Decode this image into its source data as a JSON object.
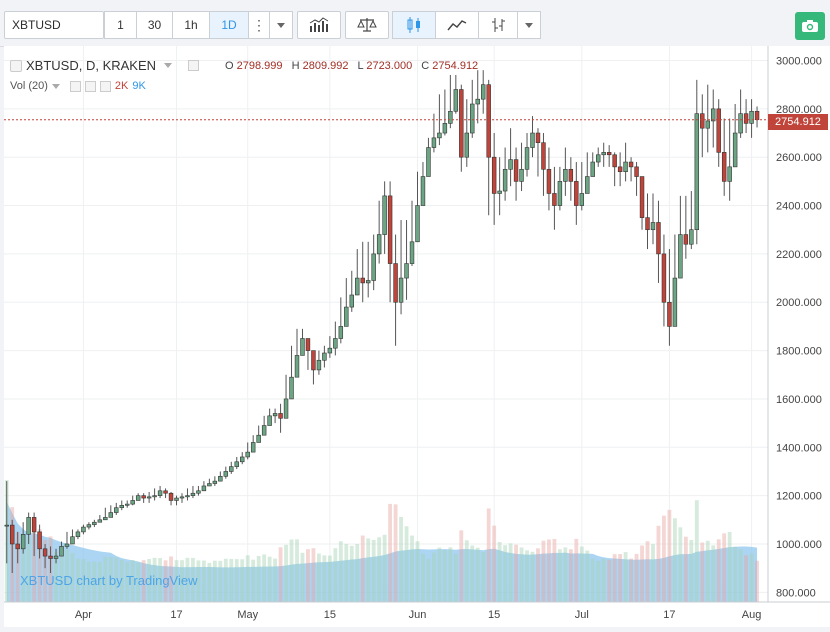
{
  "toolbar": {
    "symbol": "XBTUSD",
    "intervals": [
      {
        "label": "1",
        "active": false
      },
      {
        "label": "30",
        "active": false
      },
      {
        "label": "1h",
        "active": false
      },
      {
        "label": "1D",
        "active": true
      }
    ],
    "icons": [
      "more-dots-icon",
      "dropdown-caret-icon",
      "indicators-icon",
      "compare-icon",
      "candles-icon",
      "line-style-icon",
      "bar-style-icon",
      "dropdown-caret-icon",
      "camera-icon"
    ]
  },
  "legend": {
    "title": "XBTUSD, D, KRAKEN",
    "open_label": "O",
    "open": "2798.999",
    "high_label": "H",
    "high": "2809.992",
    "low_label": "L",
    "low": "2723.000",
    "close_label": "C",
    "close": "2754.912",
    "vol_label": "Vol (20)",
    "vol_value_1": "2K",
    "vol_value_2": "9K"
  },
  "watermark": "XBTUSD chart by TradingView",
  "colors": {
    "up": "#6ba583",
    "down": "#c0443a",
    "volume_ma": "#8fc7ee",
    "accent": "#2e96e6"
  },
  "chart_data": {
    "type": "candlestick",
    "symbol": "XBTUSD",
    "interval": "D",
    "exchange": "KRAKEN",
    "last_price": "2754.912",
    "ylim": [
      760,
      3060
    ],
    "y_ticks": [
      "3000.000",
      "2800.000",
      "2600.000",
      "2400.000",
      "2200.000",
      "2000.000",
      "1800.000",
      "1600.000",
      "1400.000",
      "1200.000",
      "1000.000",
      "800.000"
    ],
    "y_tick_values": [
      3000,
      2800,
      2600,
      2400,
      2200,
      2000,
      1800,
      1600,
      1400,
      1200,
      1000,
      800
    ],
    "x_ticks": [
      "Apr",
      "17",
      "May",
      "15",
      "Jun",
      "15",
      "Jul",
      "17",
      "Aug"
    ],
    "x_tick_index": [
      14,
      31,
      44,
      59,
      75,
      89,
      105,
      121,
      136
    ],
    "candles_close": [
      1078,
      1000,
      980,
      1040,
      1110,
      1050,
      980,
      950,
      940,
      950,
      990,
      1000,
      1030,
      1050,
      1070,
      1080,
      1090,
      1100,
      1110,
      1130,
      1150,
      1160,
      1165,
      1180,
      1200,
      1190,
      1195,
      1200,
      1220,
      1210,
      1180,
      1190,
      1195,
      1200,
      1210,
      1220,
      1240,
      1250,
      1260,
      1280,
      1300,
      1320,
      1340,
      1360,
      1380,
      1420,
      1450,
      1490,
      1530,
      1540,
      1520,
      1600,
      1690,
      1780,
      1850,
      1800,
      1720,
      1760,
      1790,
      1810,
      1850,
      1900,
      1980,
      2030,
      2100,
      2080,
      2090,
      2200,
      2280,
      2440,
      2160,
      2000,
      2100,
      2160,
      2250,
      2400,
      2520,
      2640,
      2680,
      2700,
      2740,
      2790,
      2880,
      2600,
      2700,
      2820,
      2840,
      2900,
      2600,
      2450,
      2460,
      2550,
      2590,
      2500,
      2550,
      2640,
      2700,
      2660,
      2550,
      2450,
      2400,
      2500,
      2550,
      2500,
      2400,
      2450,
      2520,
      2580,
      2610,
      2620,
      2610,
      2560,
      2540,
      2580,
      2560,
      2520,
      2350,
      2300,
      2330,
      2200,
      2000,
      1900,
      2100,
      2280,
      2240,
      2300,
      2780,
      2720,
      2750,
      2800,
      2620,
      2500,
      2560,
      2700,
      2780,
      2740,
      2790,
      2755
    ],
    "candles_high": [
      1260,
      1100,
      1050,
      1090,
      1130,
      1130,
      1080,
      1000,
      990,
      980,
      1010,
      1050,
      1060,
      1060,
      1080,
      1090,
      1100,
      1120,
      1150,
      1160,
      1170,
      1180,
      1180,
      1200,
      1210,
      1210,
      1215,
      1230,
      1240,
      1230,
      1215,
      1200,
      1210,
      1230,
      1240,
      1240,
      1260,
      1270,
      1280,
      1300,
      1320,
      1340,
      1360,
      1380,
      1420,
      1450,
      1490,
      1530,
      1560,
      1560,
      1580,
      1700,
      1820,
      1890,
      1890,
      1850,
      1790,
      1800,
      1820,
      1860,
      1920,
      2020,
      2100,
      2130,
      2220,
      2250,
      2250,
      2280,
      2420,
      2500,
      2500,
      2280,
      2340,
      2340,
      2420,
      2540,
      2580,
      2680,
      2780,
      2860,
      2880,
      2940,
      2940,
      2900,
      2840,
      2920,
      2960,
      2960,
      2920,
      2700,
      2600,
      2640,
      2720,
      2640,
      2660,
      2700,
      2770,
      2720,
      2700,
      2640,
      2560,
      2560,
      2640,
      2600,
      2580,
      2580,
      2620,
      2620,
      2640,
      2660,
      2650,
      2620,
      2620,
      2660,
      2600,
      2580,
      2500,
      2450,
      2450,
      2420,
      2280,
      2220,
      2280,
      2440,
      2440,
      2460,
      2920,
      2860,
      2900,
      2880,
      2840,
      2760,
      2760,
      2820,
      2880,
      2840,
      2840,
      2810
    ],
    "candles_low": [
      920,
      880,
      920,
      960,
      1000,
      950,
      940,
      900,
      880,
      920,
      950,
      980,
      1000,
      1020,
      1040,
      1060,
      1070,
      1090,
      1100,
      1110,
      1120,
      1140,
      1150,
      1160,
      1180,
      1170,
      1170,
      1180,
      1190,
      1190,
      1160,
      1160,
      1170,
      1180,
      1190,
      1200,
      1220,
      1240,
      1240,
      1260,
      1270,
      1290,
      1310,
      1330,
      1350,
      1400,
      1420,
      1450,
      1490,
      1500,
      1460,
      1560,
      1640,
      1700,
      1780,
      1720,
      1660,
      1700,
      1730,
      1770,
      1780,
      1830,
      1920,
      1960,
      2030,
      2000,
      2020,
      2050,
      2160,
      2200,
      2000,
      1820,
      1950,
      2010,
      2150,
      2300,
      2440,
      2580,
      2620,
      2650,
      2690,
      2720,
      2780,
      2540,
      2560,
      2680,
      2740,
      2780,
      2360,
      2320,
      2360,
      2420,
      2480,
      2420,
      2460,
      2520,
      2600,
      2520,
      2440,
      2380,
      2300,
      2380,
      2440,
      2420,
      2320,
      2380,
      2450,
      2520,
      2560,
      2560,
      2560,
      2480,
      2480,
      2500,
      2500,
      2440,
      2300,
      2220,
      2240,
      2080,
      1900,
      1820,
      1900,
      2100,
      2180,
      2220,
      2240,
      2600,
      2620,
      2640,
      2560,
      2440,
      2420,
      2600,
      2680,
      2700,
      2680,
      2723
    ]
  }
}
